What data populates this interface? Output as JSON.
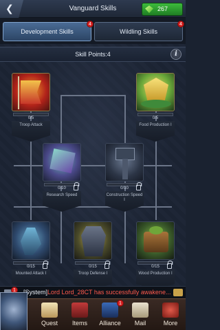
{
  "header": {
    "back_icon": "back-arrow-icon",
    "title": "Vanguard Skills",
    "gems": "267"
  },
  "tabs": [
    {
      "label": "Development Skills",
      "badge": "4",
      "active": true
    },
    {
      "label": "Wildling Skills",
      "badge": "4",
      "active": false
    }
  ],
  "skill_points": "Skill Points:4",
  "info_icon": "i",
  "skills": [
    {
      "id": "troop-attack",
      "level": "0/5",
      "name": "Troop Attack",
      "locked": false
    },
    {
      "id": "food-production",
      "level": "0/5",
      "name": "Food Production I",
      "locked": false
    },
    {
      "id": "research-speed",
      "level": "0/10",
      "name": "Research Speed",
      "locked": true
    },
    {
      "id": "construction-speed",
      "level": "0/10",
      "name": "Construction Speed I",
      "locked": true
    },
    {
      "id": "mounted-attack",
      "level": "0/15",
      "name": "Mounted Attack I",
      "locked": true
    },
    {
      "id": "troop-defense",
      "level": "0/15",
      "name": "Troop Defense I",
      "locked": true
    },
    {
      "id": "wood-production",
      "level": "0/15",
      "name": "Wood Production I",
      "locked": true
    }
  ],
  "ticker": {
    "badge": "1",
    "system": "[System]",
    "message": "Lord Lord_28CT has successfully awakene..."
  },
  "bottom_nav": [
    {
      "label": "Quest",
      "icon": "quest-scroll-icon",
      "badge": ""
    },
    {
      "label": "Items",
      "icon": "items-chest-icon",
      "badge": ""
    },
    {
      "label": "Alliance",
      "icon": "alliance-banner-icon",
      "badge": "1"
    },
    {
      "label": "Mail",
      "icon": "mail-envelope-icon",
      "badge": ""
    },
    {
      "label": "More",
      "icon": "more-menu-icon",
      "badge": ""
    }
  ]
}
